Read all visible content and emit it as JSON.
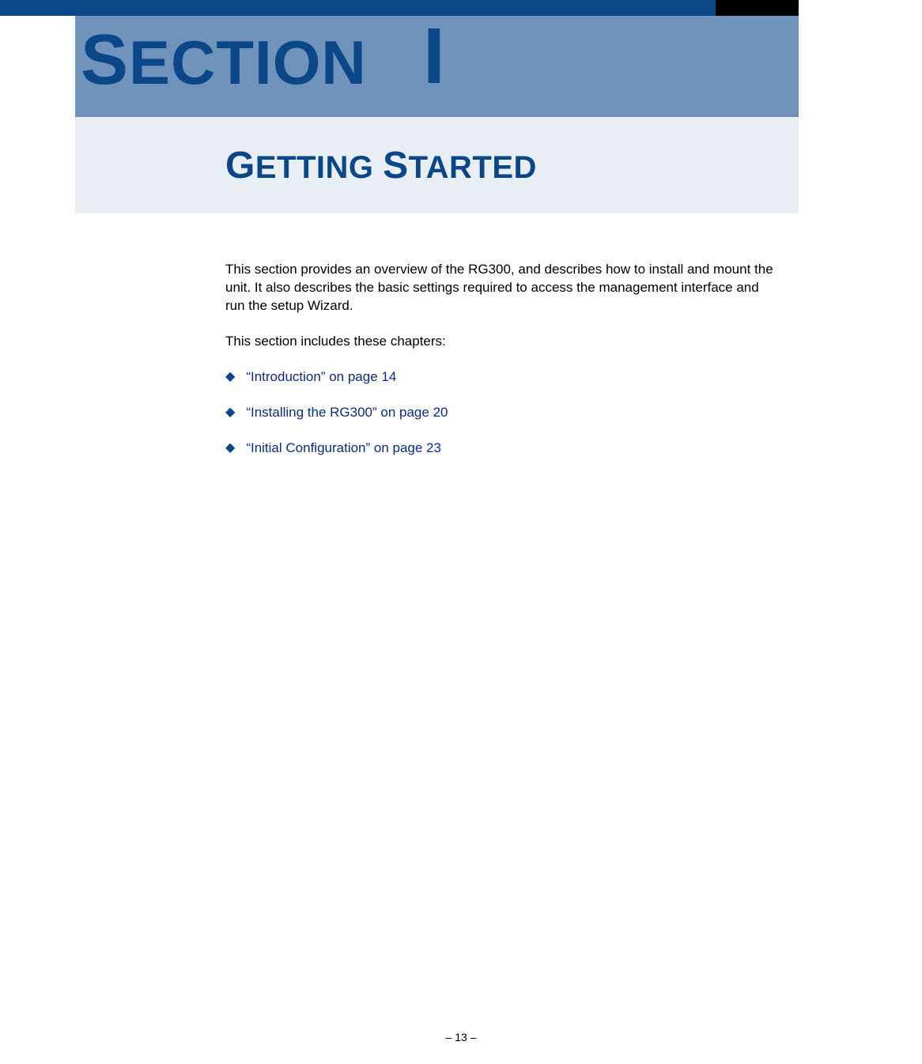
{
  "header": {
    "section_word": "SECTION",
    "section_number": "I"
  },
  "subtitle": {
    "word1_cap": "G",
    "word1_rest": "ETTING",
    "word2_cap": "S",
    "word2_rest": "TARTED"
  },
  "body": {
    "paragraph1": "This section provides an overview of the RG300, and describes how to install and mount the unit. It also describes the basic settings required to access the management interface and run the setup Wizard.",
    "paragraph2": "This section includes these chapters:"
  },
  "chapters": [
    {
      "text": "“Introduction” on page 14"
    },
    {
      "text": "“Installing the RG300” on page 20"
    },
    {
      "text": "“Initial Configuration” on page 23"
    }
  ],
  "footer": {
    "page_label": "–  13  –"
  }
}
